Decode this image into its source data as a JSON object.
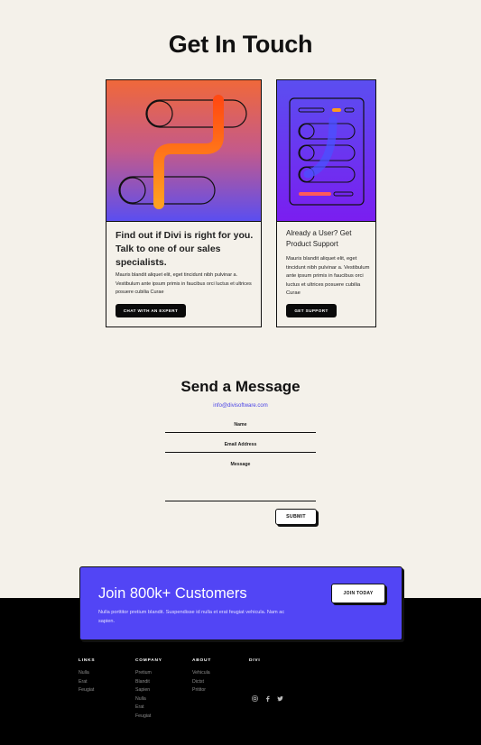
{
  "page": {
    "title": "Get In Touch"
  },
  "cards": {
    "left": {
      "heading": "Find out if Divi is right for you. Talk to one of our sales specialists.",
      "body": "Mauris blandit aliquet elit, eget tincidunt nibh pulvinar a. Vestibulum ante ipsum primis in faucibus orci luctus et ultrices posuere cubilia Curae",
      "button": "CHAT WITH AN EXPERT"
    },
    "right": {
      "heading": "Already a User? Get Product Support",
      "body": "Mauris blandit aliquet elit, eget tincidunt nibh pulvinar a. Vestibulum ante ipsum primis in faucibus orci luctus et ultrices posuere cubilia Curae",
      "button": "GET SUPPORT"
    }
  },
  "message": {
    "title": "Send a Message",
    "email": "info@divisoftware.com",
    "fields": {
      "name": "Name",
      "email": "Email Address",
      "message": "Message"
    },
    "submit": "SUBMIT"
  },
  "cta": {
    "title": "Join 800k+ Customers",
    "text": "Nulla porttitor pretium blandit. Suspendisse id nulla et erat feugiat vehicula. Nam ac sapien.",
    "button": "JOIN TODAY"
  },
  "footer": {
    "links": {
      "heading": "LINKS",
      "items": [
        "Nulla",
        "Erat",
        "Feugiat"
      ]
    },
    "company": {
      "heading": "COMPANY",
      "items": [
        "Pretium",
        "Blandit",
        "Sapien",
        "Nulla",
        "Erat",
        "Feugiat"
      ]
    },
    "about": {
      "heading": "ABOUT",
      "items": [
        "Vehicula",
        "Dictst",
        "Prititor"
      ]
    },
    "divi": {
      "heading": "DIVI"
    },
    "social": [
      "instagram-icon",
      "facebook-icon",
      "twitter-icon"
    ]
  },
  "colors": {
    "accent": "#5245f5",
    "background": "#f4f1ea",
    "footer": "#000000",
    "email_link": "#4b44e6"
  }
}
